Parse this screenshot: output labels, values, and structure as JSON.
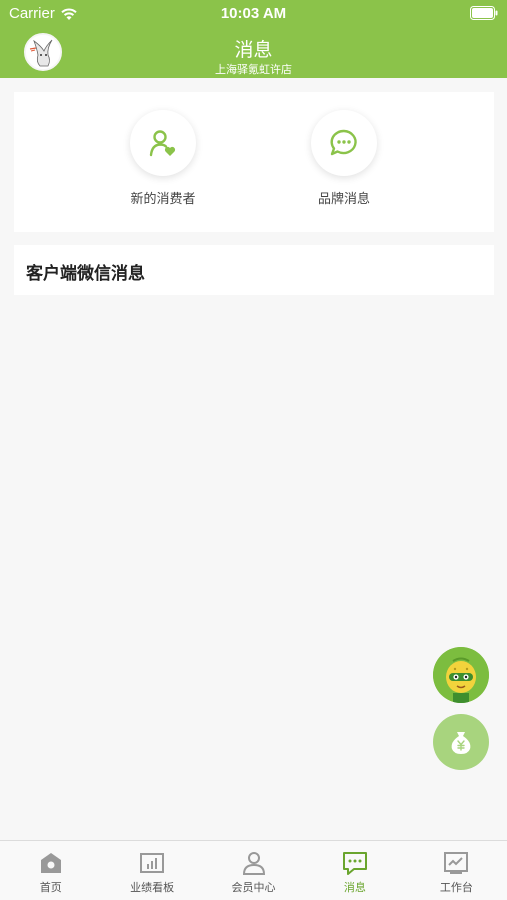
{
  "status_bar": {
    "carrier": "Carrier",
    "time": "10:03 AM"
  },
  "header": {
    "title": "消息",
    "subtitle": "上海驿氪虹许店"
  },
  "quick_actions": [
    {
      "label": "新的消费者",
      "icon": "user-heart-icon"
    },
    {
      "label": "品牌消息",
      "icon": "chat-bubble-icon"
    }
  ],
  "wechat_section": {
    "title": "客户端微信消息"
  },
  "tabbar": {
    "items": [
      {
        "label": "首页",
        "icon": "home-icon",
        "active": false
      },
      {
        "label": "业绩看板",
        "icon": "chart-board-icon",
        "active": false
      },
      {
        "label": "会员中心",
        "icon": "member-icon",
        "active": false
      },
      {
        "label": "消息",
        "icon": "message-icon",
        "active": true
      },
      {
        "label": "工作台",
        "icon": "workbench-icon",
        "active": false
      }
    ]
  },
  "colors": {
    "brand_green": "#8bc34a",
    "active_tab": "#6aa52e",
    "icon_gray": "#999999"
  }
}
